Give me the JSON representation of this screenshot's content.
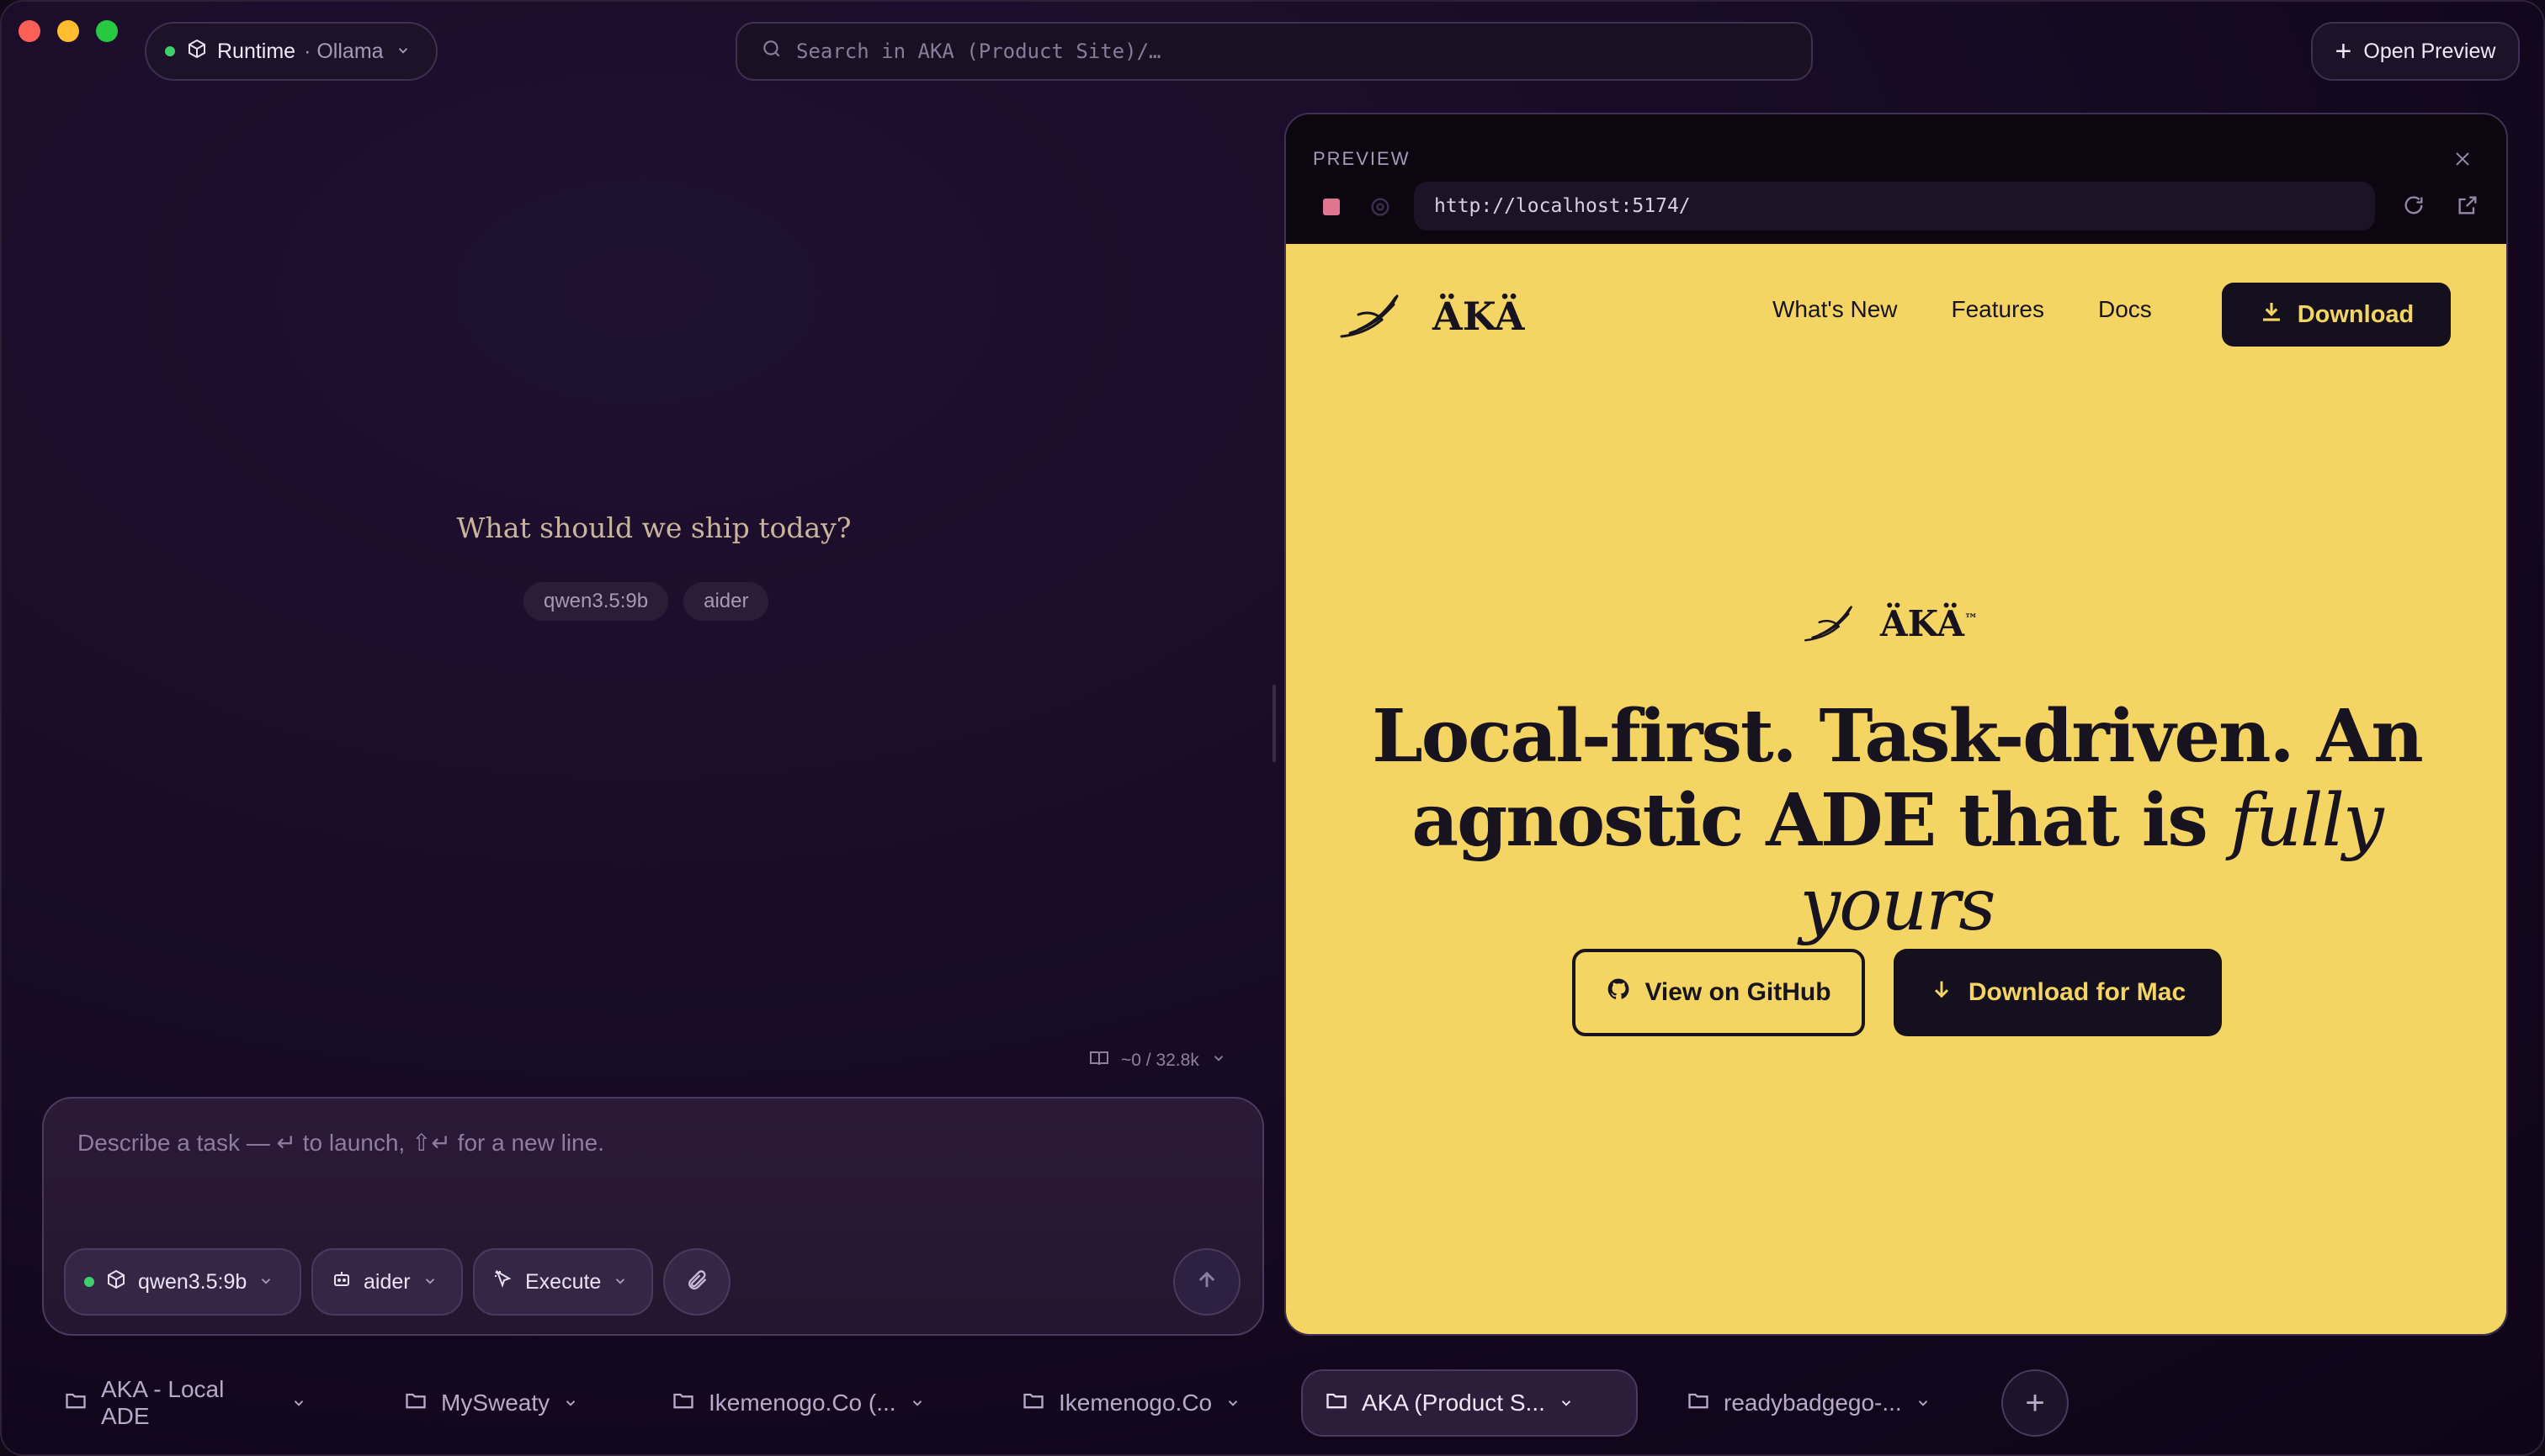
{
  "header": {
    "runtime": {
      "label": "Runtime",
      "provider": "· Ollama"
    },
    "search": {
      "placeholder": "Search in AKA (Product Site)/…"
    },
    "open_preview_label": "Open Preview"
  },
  "main": {
    "prompt_title": "What should we ship today?",
    "chips": [
      "qwen3.5:9b",
      "aider"
    ],
    "context_meter": "~0 / 32.8k",
    "task_input": {
      "placeholder": "Describe a task — ↵ to launch, ⇧↵ for a new line.",
      "model_label": "qwen3.5:9b",
      "agent_label": "aider",
      "mode_label": "Execute"
    }
  },
  "preview": {
    "label": "PREVIEW",
    "url": "http://localhost:5174/",
    "site": {
      "brand": "ÄKÄ",
      "nav": [
        "What's New",
        "Features",
        "Docs"
      ],
      "download_label": "Download",
      "hero_brand": "ÄKÄ",
      "hero_tm": "™",
      "headline_plain": "Local-first. Task-driven. An agnostic ADE that is ",
      "headline_em": "fully yours",
      "github_label": "View on GitHub",
      "mac_label": "Download for Mac"
    }
  },
  "tabs": [
    {
      "label": "AKA - Local ADE",
      "active": false
    },
    {
      "label": "MySweaty",
      "active": false
    },
    {
      "label": "Ikemenogo.Co (...",
      "active": false
    },
    {
      "label": "Ikemenogo.Co",
      "active": false
    },
    {
      "label": "AKA (Product S...",
      "active": true
    },
    {
      "label": "readybadgego-...",
      "active": false
    }
  ],
  "colors": {
    "accent_yellow": "#f4d462",
    "dark": "#15101e",
    "status_green": "#3fcf6b",
    "stop_red": "#e07590"
  },
  "icons": [
    "cube-icon",
    "search-icon",
    "plus-icon",
    "folder-icon",
    "chevron-down-icon",
    "paperclip-icon",
    "arrow-up-icon",
    "book-icon",
    "reload-icon",
    "external-link-icon",
    "close-icon",
    "hand-logo-icon",
    "github-icon",
    "download-icon",
    "cursor-icon",
    "robot-icon"
  ]
}
